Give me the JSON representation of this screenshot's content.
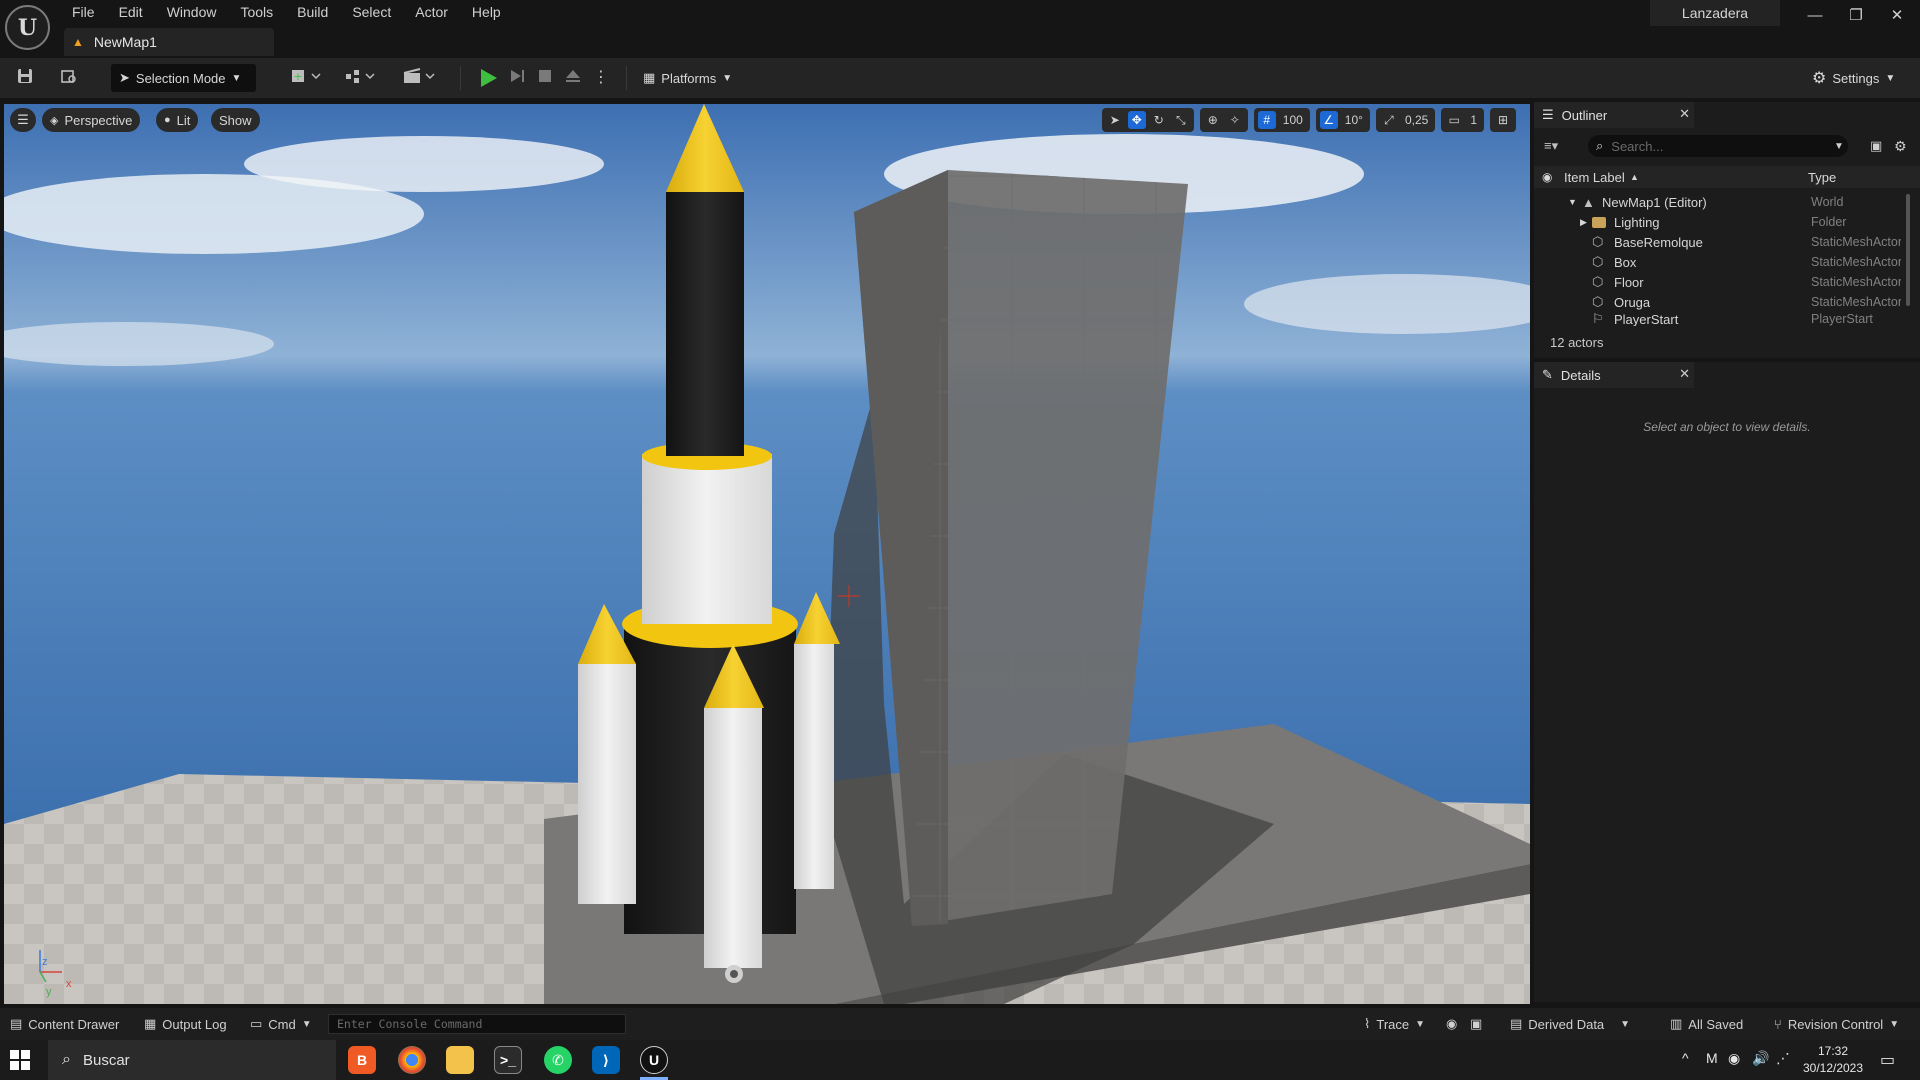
{
  "menu": [
    "File",
    "Edit",
    "Window",
    "Tools",
    "Build",
    "Select",
    "Actor",
    "Help"
  ],
  "document_tab": "NewMap1",
  "project_name": "Lanzadera",
  "window_controls": {
    "minimize": "—",
    "restore": "❐",
    "close": "✕"
  },
  "toolbar": {
    "selection_mode": "Selection Mode",
    "platforms": "Platforms",
    "settings": "Settings"
  },
  "viewport": {
    "perspective": "Perspective",
    "lit": "Lit",
    "show": "Show",
    "grid_snap": "100",
    "rotation_snap": "10°",
    "scale_snap": "0,25",
    "camera_speed": "1",
    "axis_z": "z",
    "axis_x": "x",
    "axis_y": "y"
  },
  "outliner": {
    "title": "Outliner",
    "search_placeholder": "Search...",
    "col_label": "Item Label",
    "col_type": "Type",
    "rows": [
      {
        "label": "NewMap1 (Editor)",
        "type": "World"
      },
      {
        "label": "Lighting",
        "type": "Folder"
      },
      {
        "label": "BaseRemolque",
        "type": "StaticMeshActor"
      },
      {
        "label": "Box",
        "type": "StaticMeshActor"
      },
      {
        "label": "Floor",
        "type": "StaticMeshActor"
      },
      {
        "label": "Oruga",
        "type": "StaticMeshActor"
      },
      {
        "label": "PlayerStart",
        "type": "PlayerStart"
      }
    ],
    "count": "12 actors"
  },
  "details": {
    "title": "Details",
    "empty_text": "Select an object to view details."
  },
  "statusbar": {
    "content_drawer": "Content Drawer",
    "output_log": "Output Log",
    "cmd": "Cmd",
    "console_placeholder": "Enter Console Command",
    "trace": "Trace",
    "derived_data": "Derived Data",
    "all_saved": "All Saved",
    "revision_control": "Revision Control"
  },
  "taskbar": {
    "search": "Buscar",
    "time": "17:32",
    "date": "30/12/2023"
  },
  "colors": {
    "accent_blue": "#1d6ad6",
    "play_green": "#3fbf3f",
    "rocket_yellow": "#f2c511"
  }
}
